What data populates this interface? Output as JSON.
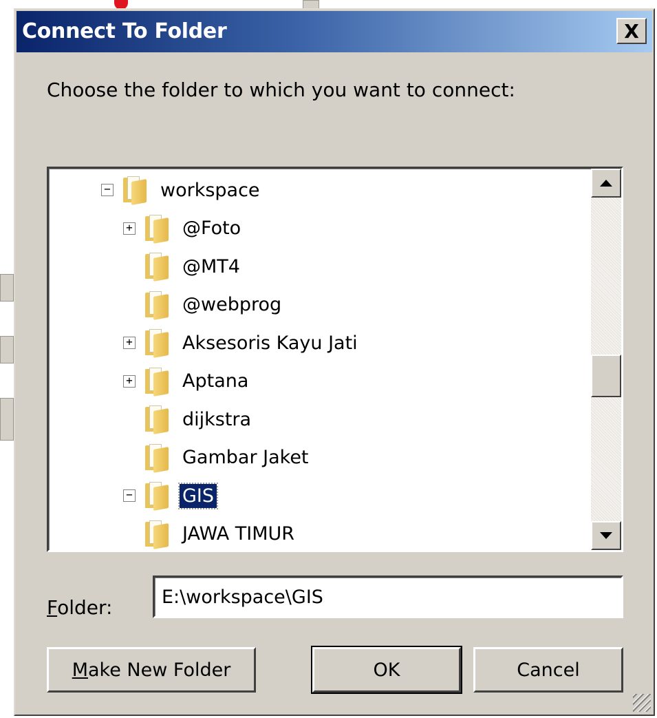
{
  "dialog": {
    "title": "Connect To Folder",
    "close_label": "X",
    "prompt": "Choose the folder to which you want to connect:"
  },
  "tree": {
    "items": [
      {
        "label": "workspace",
        "expander": "−",
        "level": 0,
        "selected": false
      },
      {
        "label": "@Foto",
        "expander": "+",
        "level": 1,
        "selected": false
      },
      {
        "label": "@MT4",
        "expander": "",
        "level": 1,
        "selected": false
      },
      {
        "label": "@webprog",
        "expander": "",
        "level": 1,
        "selected": false
      },
      {
        "label": "Aksesoris Kayu Jati",
        "expander": "+",
        "level": 1,
        "selected": false
      },
      {
        "label": "Aptana",
        "expander": "+",
        "level": 1,
        "selected": false
      },
      {
        "label": "dijkstra",
        "expander": "",
        "level": 1,
        "selected": false
      },
      {
        "label": "Gambar Jaket",
        "expander": "",
        "level": 1,
        "selected": false
      },
      {
        "label": "GIS",
        "expander": "−",
        "level": 1,
        "selected": true
      },
      {
        "label": "JAWA TIMUR",
        "expander": "",
        "level": 2,
        "selected": false
      }
    ]
  },
  "folder_field": {
    "label_access": "F",
    "label_rest": "older:",
    "value": "E:\\workspace\\GIS"
  },
  "buttons": {
    "make_new_access": "M",
    "make_new_rest": "ake New Folder",
    "ok": "OK",
    "cancel": "Cancel"
  },
  "colors": {
    "title_gradient_start": "#0a246a",
    "title_gradient_end": "#a6caf0",
    "dialog_face": "#d4d0c8",
    "selection": "#0a246a"
  }
}
